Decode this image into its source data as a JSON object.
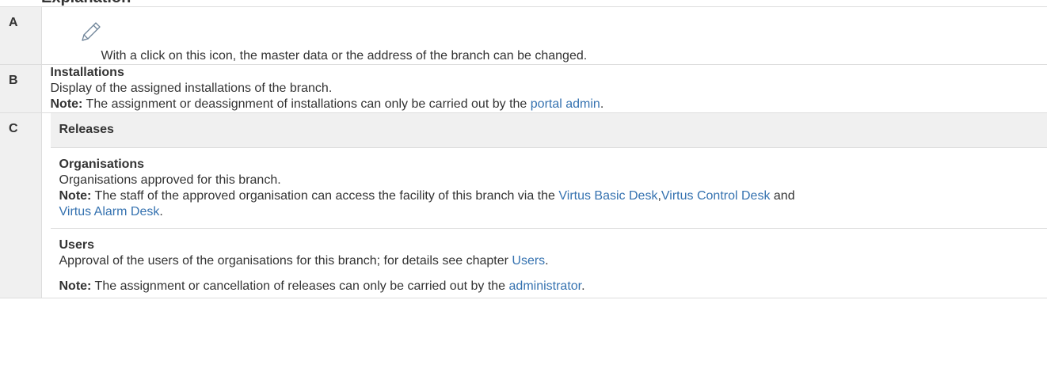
{
  "heading": "Explanation",
  "rows": {
    "a": {
      "key": "A",
      "icon": "pencil-icon",
      "text": "With a click on this icon, the master data or the address of the branch can be changed."
    },
    "b": {
      "key": "B",
      "title": "Installations",
      "desc": "Display of the assigned installations of the branch.",
      "note_label": "Note:",
      "note_text": "The assignment or deassignment of installations can only be carried out by the",
      "note_link": "portal admin",
      "note_end": "."
    },
    "c": {
      "key": "C",
      "title": "Releases",
      "organisations": {
        "title": "Organisations",
        "desc": "Organisations approved for this branch.",
        "note_label": "Note:",
        "note_text": "The staff of the approved organisation can access the facility of this branch via the",
        "link1": "Virtus Basic Desk",
        "sep": ",",
        "link2": "Virtus Control Desk",
        "and": "and",
        "link3": "Virtus Alarm Desk",
        "end": "."
      },
      "users": {
        "title": "Users",
        "desc": "Approval of the users of the organisations for this branch; for details see chapter",
        "link": "Users",
        "end": ".",
        "note_label": "Note:",
        "note_text": "The assignment or cancellation of releases can only be carried out by the",
        "note_link": "administrator",
        "note_end": "."
      }
    }
  }
}
